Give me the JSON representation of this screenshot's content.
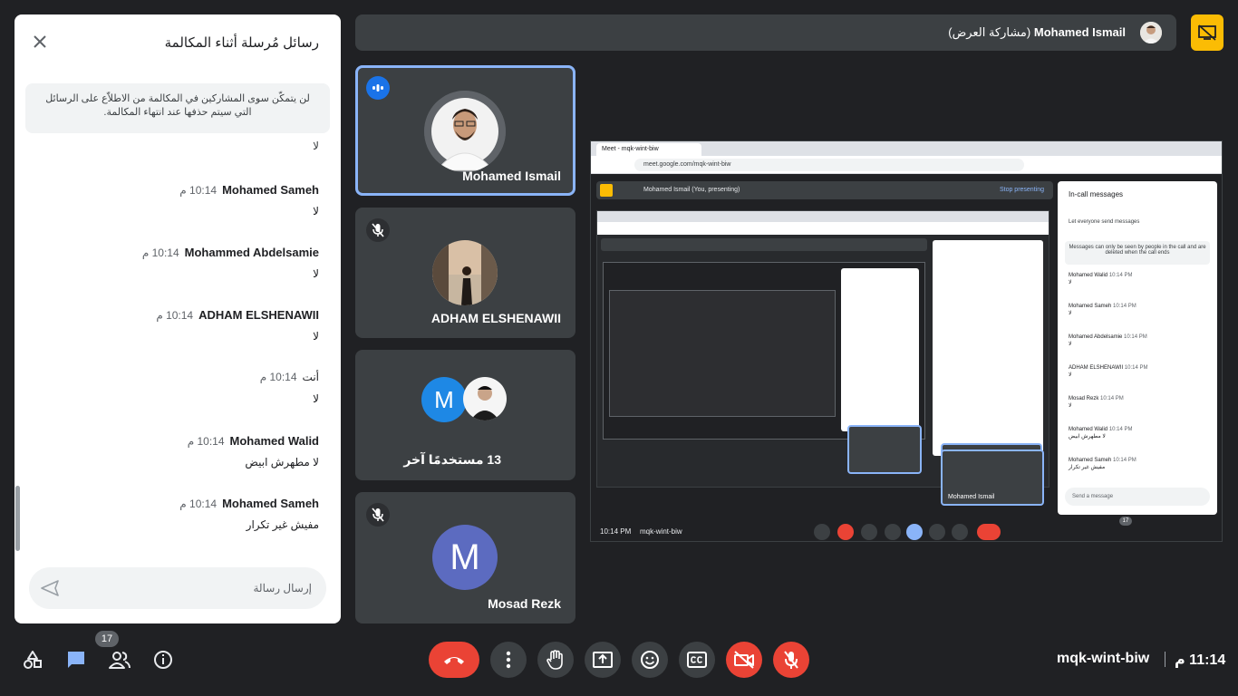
{
  "chat": {
    "title": "رسائل مُرسلة أثناء المكالمة",
    "notice": "لن يتمكّن سوى المشاركين في المكالمة من الاطلاّع على الرسائل التي سيتم حذفها عند انتهاء المكالمة.",
    "residue": "لا",
    "messages": [
      {
        "sender": "Mohamed Sameh",
        "time": "10:14 م",
        "text": "لا"
      },
      {
        "sender": "Mohammed Abdelsamie",
        "time": "10:14 م",
        "text": "لا"
      },
      {
        "sender": "ADHAM ELSHENAWII",
        "time": "10:14 م",
        "text": "لا"
      },
      {
        "sender": "أنت",
        "time": "10:14 م",
        "text": "لا"
      },
      {
        "sender": "Mohamed Walid",
        "time": "10:14 م",
        "text": "لا مطهرش ابيض"
      },
      {
        "sender": "Mohamed Sameh",
        "time": "10:14 م",
        "text": "مفيش غير تكرار"
      }
    ],
    "input_placeholder": "إرسال رسالة"
  },
  "presenter": {
    "name": "Mohamed Ismail",
    "suffix": "(مشاركة العرض)"
  },
  "tiles": [
    {
      "name": "Mohamed Ismail",
      "state": "speaking"
    },
    {
      "name": "ADHAM ELSHENAWII",
      "state": "muted"
    },
    {
      "name": "13 مستخدمًا آخر",
      "letter": "M"
    },
    {
      "name": "Mosad Rezk",
      "state": "muted",
      "letter": "M"
    }
  ],
  "shared_screen": {
    "tab_title": "Meet - mqk-wint-biw",
    "url": "meet.google.com/mqk-wint-biw",
    "bar_text": "Mohamed Ismail (You, presenting)",
    "stop_label": "Stop presenting",
    "incall_title": "In-call messages",
    "incall_toggle": "Let everyone send messages",
    "incall_notice": "Messages can only be seen by people in the call and are deleted when the call ends",
    "incall_messages": [
      {
        "sender": "Mohamed Walid",
        "time": "10:14 PM",
        "text": "لا"
      },
      {
        "sender": "Mohamed Sameh",
        "time": "10:14 PM",
        "text": "لا"
      },
      {
        "sender": "Mohamed Abdelsamie",
        "time": "10:14 PM",
        "text": "لا"
      },
      {
        "sender": "ADHAM ELSHENAWII",
        "time": "10:14 PM",
        "text": "لا"
      },
      {
        "sender": "Mosad Rezk",
        "time": "10:14 PM",
        "text": "لا"
      },
      {
        "sender": "Mohamed Walid",
        "time": "10:14 PM",
        "text": "لا مطهرش ابيض"
      },
      {
        "sender": "Mohamed Sameh",
        "time": "10:14 PM",
        "text": "مفيش غير تكرار"
      }
    ],
    "incall_input": "Send a message",
    "bottom_time": "10:14 PM",
    "bottom_code": "mqk-wint-biw",
    "tile_name": "Mohamed Ismail",
    "people_badge": "17"
  },
  "bottom": {
    "people_count": "17",
    "meeting_code": "mqk-wint-biw",
    "clock": "11:14 م"
  },
  "colors": {
    "background": "#202124",
    "tile": "#3c4043",
    "accent_blue": "#8ab4f8",
    "present_yellow": "#fbbc04",
    "leave_red": "#ea4335",
    "avatar_blue": "#1e88e5",
    "avatar_indigo": "#5c6bc0"
  },
  "icons": {
    "present": "presentation-off-icon",
    "close": "close-icon",
    "send": "send-icon",
    "mic_off": "mic-off-icon",
    "speaking": "audio-level-icon"
  }
}
